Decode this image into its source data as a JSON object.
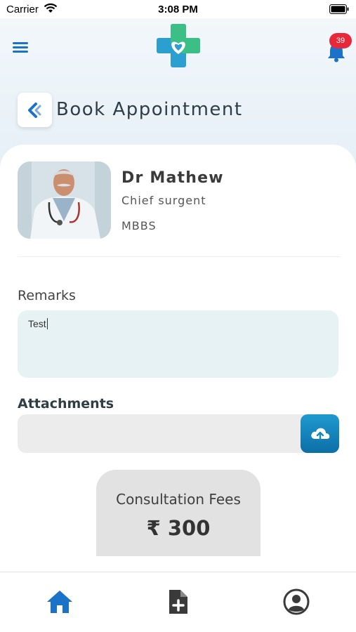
{
  "status_bar": {
    "carrier": "Carrier",
    "time": "3:08 PM"
  },
  "header": {
    "notification_count": "39",
    "icons": [
      "menu-icon",
      "app-logo",
      "bell-icon"
    ]
  },
  "page": {
    "title": "Book Appointment",
    "back_icon": "chevron-left-icon"
  },
  "doctor": {
    "name": "Dr Mathew",
    "role": "Chief surgent",
    "degree": "MBBS"
  },
  "form": {
    "remarks_label": "Remarks",
    "remarks_value": "Test",
    "attachments_label": "Attachments",
    "upload_icon": "cloud-upload-icon"
  },
  "fees": {
    "label": "Consultation Fees",
    "amount": "₹ 300"
  },
  "tabs": [
    {
      "name": "home",
      "icon": "home-icon",
      "active": true
    },
    {
      "name": "add-record",
      "icon": "document-plus-icon",
      "active": false
    },
    {
      "name": "profile",
      "icon": "user-circle-icon",
      "active": false
    }
  ],
  "colors": {
    "accent": "#1a73c8",
    "badge": "#e8283a",
    "remarks_bg": "#e6f2f4",
    "upload_btn": "#1686bf"
  }
}
